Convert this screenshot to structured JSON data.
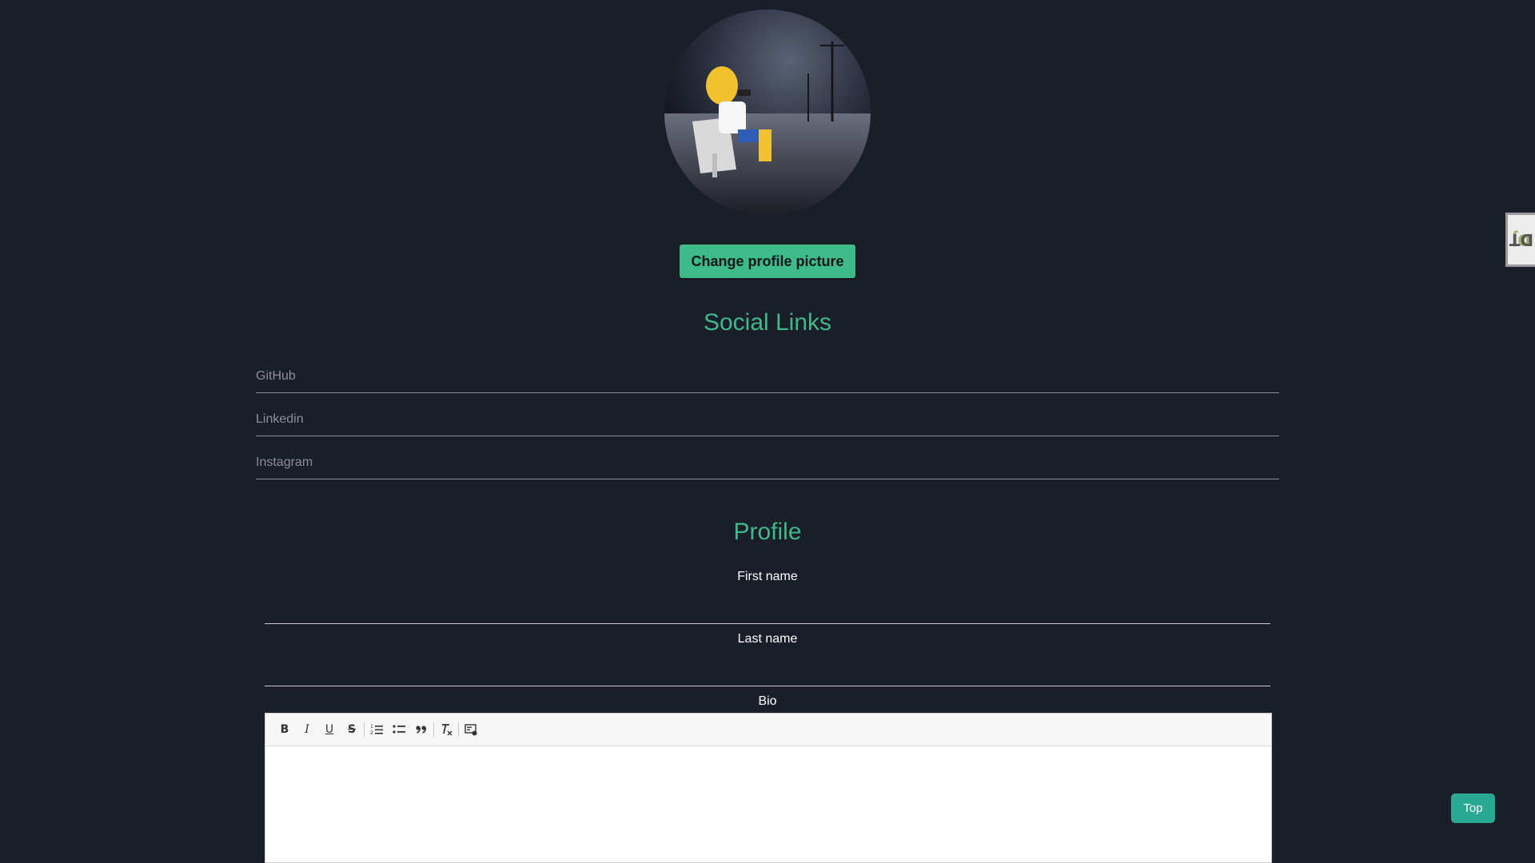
{
  "profile_picture": {
    "change_button_label": "Change profile picture"
  },
  "social": {
    "title": "Social Links",
    "github_placeholder": "GitHub",
    "linkedin_placeholder": "Linkedin",
    "instagram_placeholder": "Instagram"
  },
  "profile": {
    "title": "Profile",
    "first_name_label": "First name",
    "first_name_value": "",
    "last_name_label": "Last name",
    "last_name_value": "",
    "bio_label": "Bio"
  },
  "editor": {
    "toolbar": [
      {
        "name": "bold",
        "glyph": "B"
      },
      {
        "name": "italic",
        "glyph": "I"
      },
      {
        "name": "underline",
        "glyph": "U"
      },
      {
        "name": "strike",
        "glyph": "S"
      },
      {
        "name": "ordered-list",
        "glyph": ""
      },
      {
        "name": "bullet-list",
        "glyph": ""
      },
      {
        "name": "blockquote",
        "glyph": "99"
      },
      {
        "name": "clear-format",
        "glyph": "Tx"
      },
      {
        "name": "code-block",
        "glyph": ""
      }
    ]
  },
  "scroll_top": {
    "label": "Top"
  },
  "debug_toolbar": {
    "label_dj": "Dj",
    "label_dt": "DT"
  },
  "colors": {
    "background": "#1a1e28",
    "accent": "#3fb98a",
    "top_button": "#2aa894"
  }
}
